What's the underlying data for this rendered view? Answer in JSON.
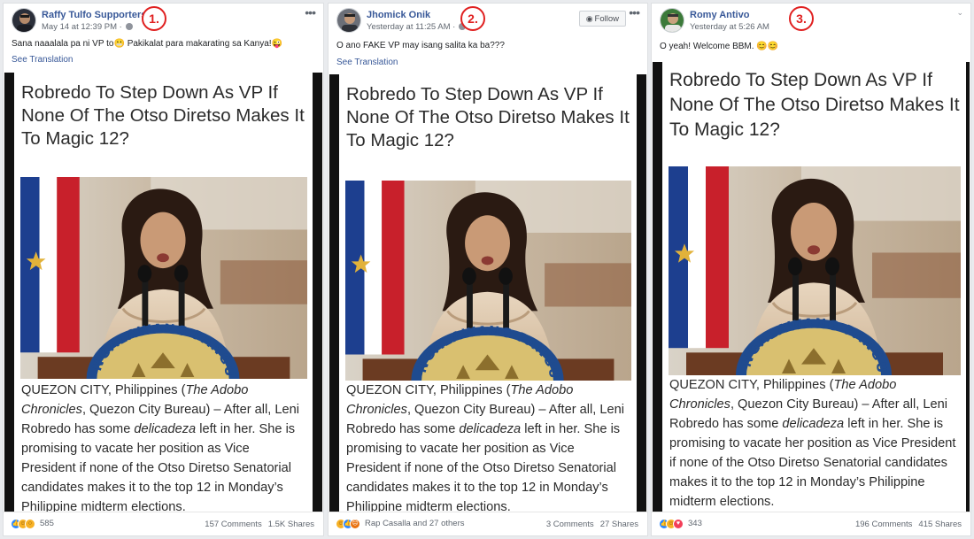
{
  "posts": [
    {
      "badge": "1.",
      "author": "Raffy Tulfo Supporters",
      "timestamp": "May 14 at 12:39 PM ·",
      "caption": "Sana naaalala pa ni VP to😬 Pakikalat para makarating sa Kanya!😜",
      "see_translation": "See Translation",
      "headline": "Robredo To Step Down As VP If None Of The Otso Diretso Makes It To Magic 12?",
      "article_html": "QUEZON CITY, Philippines (<i>The Adobo Chronicles</i>, Quezon City Bureau) – After all, Leni Robredo has some <i>delicadeza</i> left in her. She is promising to vacate her position as Vice President if none of the Otso Diretso Senatorial candidates makes it to the top 12 in Monday’s Philippine midterm elections.",
      "reaction_count": "585",
      "comments": "157 Comments",
      "shares": "1.5K Shares",
      "has_follow": false
    },
    {
      "badge": "2.",
      "author": "Jhomick Onik",
      "timestamp": "Yesterday at 11:25 AM ·",
      "caption": "O ano FAKE VP may isang salita ka ba???",
      "see_translation": "See Translation",
      "follow_label": "Follow",
      "headline": "Robredo To Step Down As VP If None Of The Otso Diretso Makes It To Magic 12?",
      "article_html": "QUEZON CITY, Philippines (<i>The Adobo Chronicles</i>, Quezon City Bureau) – After all, Leni Robredo has some <i>delicadeza</i> left in her. She is promising to vacate her position as Vice President if none of the Otso Diretso Senatorial candidates makes it to the top 12 in Monday’s Philippine midterm elections.",
      "reaction_count": "Rap Casalla and 27 others",
      "comments": "3 Comments",
      "shares": "27 Shares",
      "has_follow": true
    },
    {
      "badge": "3.",
      "author": "Romy Antivo",
      "timestamp": "Yesterday at 5:26 AM",
      "caption": "O yeah! Welcome BBM. 😊😊",
      "headline": "Robredo To Step Down As VP If None Of The Otso Diretso Makes It To Magic 12?",
      "article_html": "QUEZON CITY, Philippines (<i>The Adobo Chronicles</i>, Quezon City Bureau) – After all, Leni Robredo has some <i>delicadeza</i> left in her. She is promising to vacate her position as Vice President if none of the Otso Diretso Senatorial candidates makes it to the top 12 in Monday’s Philippine midterm elections.",
      "reaction_count": "343",
      "comments": "196 Comments",
      "shares": "415 Shares",
      "has_follow": false
    }
  ],
  "photo_seal_text": "NGALAWANG PANGU",
  "icons": {
    "more": "more-options-icon",
    "globe": "public-globe-icon",
    "rss": "rss-icon",
    "chevron": "chevron-down-icon"
  },
  "colors": {
    "link": "#385898",
    "badge": "#e02020",
    "background": "#e9ebee"
  }
}
